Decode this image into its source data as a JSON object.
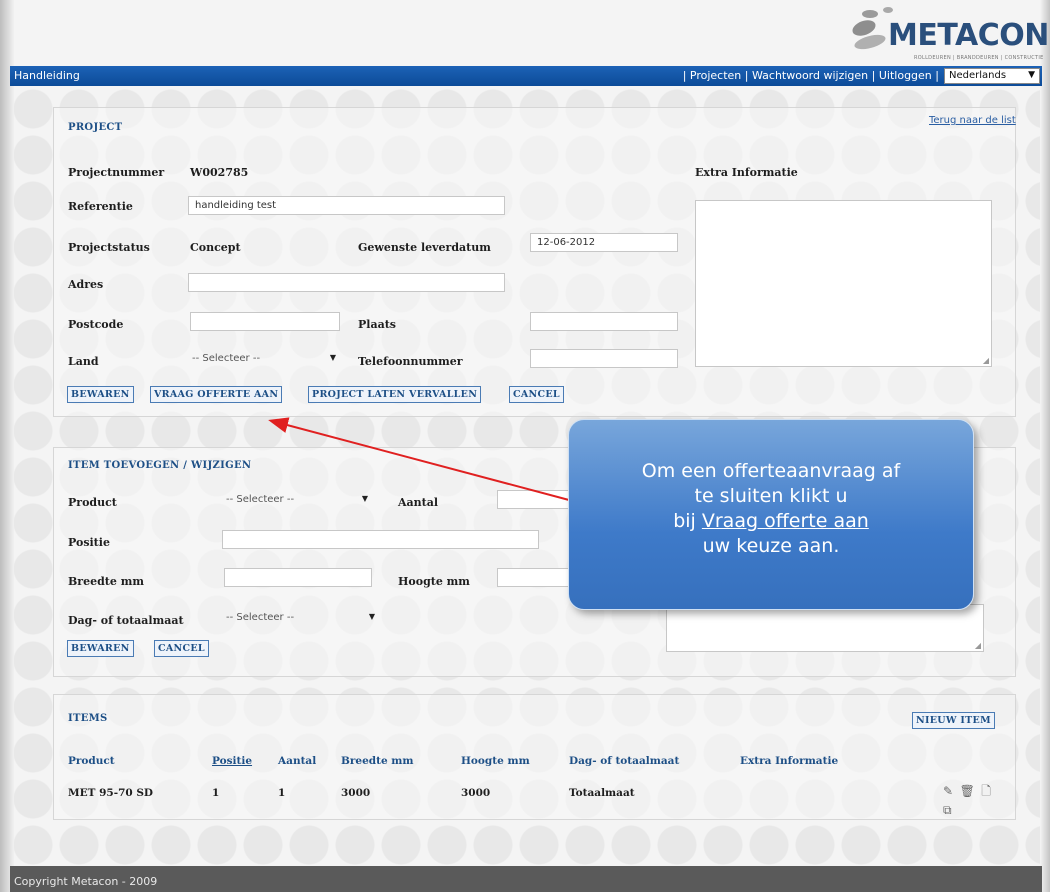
{
  "header": {
    "logo_text": "METACON",
    "logo_sub": "ROLLDEUREN | BRANDDEUREN | CONSTRUCTIE"
  },
  "nav": {
    "left_label": "Handleiding",
    "items": [
      "Projecten",
      "Wachtwoord wijzigen",
      "Uitloggen"
    ],
    "separator": "|",
    "language": "Nederlands"
  },
  "project": {
    "section_title": "PROJECT",
    "back_link": "Terug naar de list",
    "projectnummer_label": "Projectnummer",
    "projectnummer_value": "W002785",
    "referentie_label": "Referentie",
    "referentie_value": "handleiding test",
    "projectstatus_label": "Projectstatus",
    "projectstatus_value": "Concept",
    "leverdatum_label": "Gewenste leverdatum",
    "leverdatum_value": "12-06-2012",
    "adres_label": "Adres",
    "postcode_label": "Postcode",
    "plaats_label": "Plaats",
    "land_label": "Land",
    "land_value": "-- Selecteer --",
    "telefoon_label": "Telefoonnummer",
    "extra_label": "Extra Informatie",
    "buttons": {
      "save": "BEWAREN",
      "offerte": "VRAAG OFFERTE AAN",
      "vervallen": "PROJECT LATEN VERVALLEN",
      "cancel": "CANCEL"
    }
  },
  "item_form": {
    "section_title": "ITEM TOEVOEGEN / WIJZIGEN",
    "product_label": "Product",
    "product_value": "-- Selecteer --",
    "aantal_label": "Aantal",
    "positie_label": "Positie",
    "breedte_label": "Breedte mm",
    "hoogte_label": "Hoogte mm",
    "maat_label": "Dag- of totaalmaat",
    "maat_value": "-- Selecteer --",
    "buttons": {
      "save": "BEWAREN",
      "cancel": "CANCEL"
    }
  },
  "items": {
    "section_title": "ITEMS",
    "new_button": "NIEUW ITEM",
    "columns": [
      "Product",
      "Positie",
      "Aantal",
      "Breedte mm",
      "Hoogte mm",
      "Dag- of totaalmaat",
      "Extra Informatie"
    ],
    "rows": [
      {
        "product": "MET 95-70 SD",
        "positie": "1",
        "aantal": "1",
        "breedte": "3000",
        "hoogte": "3000",
        "maat": "Totaalmaat",
        "extra": ""
      }
    ],
    "row_icons": [
      "edit-icon",
      "delete-icon",
      "document-icon",
      "copy-icon"
    ]
  },
  "callout": {
    "line1": "Om een offerteaanvraag af",
    "line2": "te sluiten klikt u",
    "line3_prefix": "bij",
    "line3_link": "Vraag offerte aan",
    "line4": "uw keuze aan.",
    "arrow_color": "#e02020"
  },
  "footer": {
    "text": "Copyright Metacon - 2009"
  },
  "colors": {
    "nav_blue": "#0c4b98",
    "section_blue": "#1d4f86",
    "callout_blue": "#3e7ac9"
  }
}
